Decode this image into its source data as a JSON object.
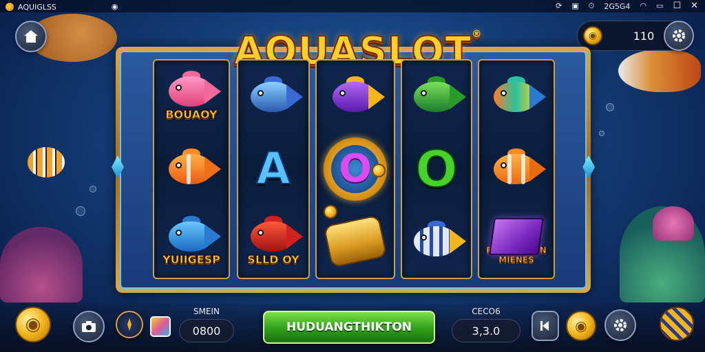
{
  "status_bar": {
    "app_name": "AQUIGLSS",
    "signal_text": "2G5G4",
    "icons": [
      "refresh-icon",
      "screenshot-icon",
      "alarm-icon",
      "signal-icon",
      "wifi-icon",
      "window-icon"
    ]
  },
  "window_controls": {
    "minimize": "—",
    "maximize": "☐",
    "close": "✕"
  },
  "game": {
    "title": "AQUASLOT",
    "title_mark": "®",
    "coins": "110",
    "accent_gold": "#ffd02a",
    "accent_green": "#3fb01f"
  },
  "reels": [
    {
      "symbols": [
        {
          "kind": "fish",
          "name": "pink-fish",
          "label": "BOUAOY"
        },
        {
          "kind": "fish",
          "name": "orange-fish",
          "label": ""
        },
        {
          "kind": "fish",
          "name": "blue-fish",
          "label": "YUIIGESP"
        }
      ]
    },
    {
      "symbols": [
        {
          "kind": "fish",
          "name": "blue-fish",
          "label": ""
        },
        {
          "kind": "letter",
          "name": "letter-a",
          "label": "A"
        },
        {
          "kind": "fish",
          "name": "red-fish",
          "label": "SLLD OY"
        }
      ]
    },
    {
      "symbols": [
        {
          "kind": "fish",
          "name": "purple-fish",
          "label": ""
        },
        {
          "kind": "ring",
          "name": "gold-ring-o",
          "label": "O"
        },
        {
          "kind": "scroll",
          "name": "gold-scroll",
          "label": ""
        }
      ]
    },
    {
      "symbols": [
        {
          "kind": "fish",
          "name": "green-fish",
          "label": ""
        },
        {
          "kind": "letter",
          "name": "letter-o",
          "label": "O"
        },
        {
          "kind": "fish",
          "name": "striped-fish",
          "label": ""
        }
      ]
    },
    {
      "symbols": [
        {
          "kind": "fish",
          "name": "tropical-fish",
          "label": ""
        },
        {
          "kind": "fish",
          "name": "clown-fish",
          "label": ""
        },
        {
          "kind": "jewel",
          "name": "purple-jewel",
          "label": "PERMIIONON MIENES"
        }
      ]
    }
  ],
  "bottom": {
    "bet_label": "SMEIN",
    "bet_value": "0800",
    "spin_label": "HUDUANGTHIKTON",
    "win_label": "CECO6",
    "win_value": "3,3.0"
  }
}
